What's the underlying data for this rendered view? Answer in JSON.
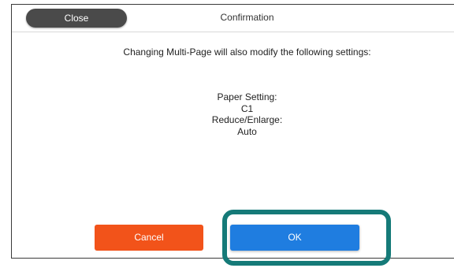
{
  "header": {
    "close_label": "Close",
    "title": "Confirmation"
  },
  "message": "Changing Multi-Page will also modify the following settings:",
  "settings": [
    {
      "name": "Paper Setting:",
      "value": "C1"
    },
    {
      "name": "Reduce/Enlarge:",
      "value": "Auto"
    }
  ],
  "buttons": {
    "cancel_label": "Cancel",
    "ok_label": "OK"
  },
  "colors": {
    "close_bg": "#4a4a4a",
    "cancel_bg": "#f2531a",
    "ok_bg": "#1f7de0",
    "highlight": "#157a78"
  }
}
